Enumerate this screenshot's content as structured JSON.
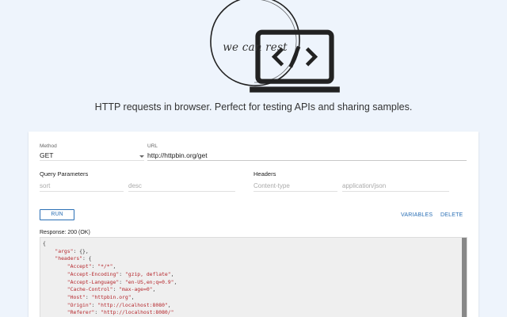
{
  "logo": {
    "text": "we can rest",
    "icon": "laptop-code-icon"
  },
  "tagline": "HTTP requests in browser. Perfect for testing APIs and sharing samples.",
  "request": {
    "method_label": "Method",
    "method_value": "GET",
    "url_label": "URL",
    "url_value": "http://httpbin.org/get"
  },
  "query_parameters": {
    "title": "Query Parameters",
    "key_placeholder": "sort",
    "value_placeholder": "desc"
  },
  "headers": {
    "title": "Headers",
    "key_placeholder": "Content-type",
    "value_placeholder": "application/json"
  },
  "actions": {
    "run": "RUN",
    "variables": "VARIABLES",
    "delete": "DELETE"
  },
  "response": {
    "label": "Response: 200 (OK)",
    "lines": [
      "{",
      "    \"args\": {},",
      "    \"headers\": {",
      "        \"Accept\": \"*/*\",",
      "        \"Accept-Encoding\": \"gzip, deflate\",",
      "        \"Accept-Language\": \"en-US,en;q=0.9\",",
      "        \"Cache-Control\": \"max-age=0\",",
      "        \"Host\": \"httpbin.org\",",
      "        \"Origin\": \"http://localhost:8080\",",
      "        \"Referer\": \"http://localhost:8080/\""
    ]
  },
  "colors": {
    "background": "#eef4fc",
    "accent": "#2a6fb5",
    "json_key": "#b5262b"
  }
}
